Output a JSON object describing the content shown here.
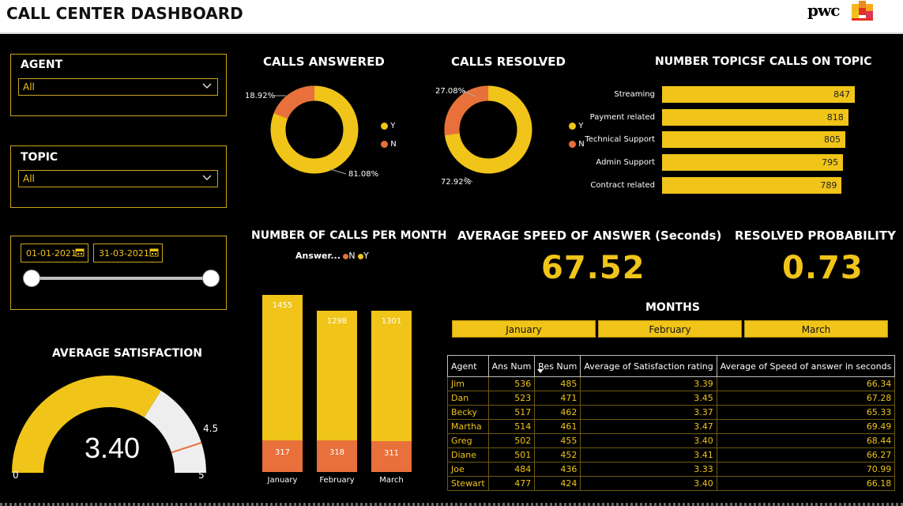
{
  "header": {
    "title": "CALL CENTER DASHBOARD",
    "logo_text": "pwc"
  },
  "colors": {
    "yellow": "#F0C419",
    "orange": "#E8703A",
    "panel_border": "#C7A420",
    "gauge_rest": "#EEEEEE"
  },
  "filters": {
    "agent": {
      "label": "AGENT",
      "value": "All"
    },
    "topic": {
      "label": "TOPIC",
      "value": "All"
    },
    "date": {
      "start": "01-01-2021",
      "end": "31-03-2021"
    }
  },
  "calls_answered": {
    "title": "CALLS ANSWERED",
    "legend": [
      {
        "label": "Y",
        "color": "#F0C419"
      },
      {
        "label": "N",
        "color": "#E8703A"
      }
    ],
    "label_y": "81.08%",
    "label_n": "18.92%"
  },
  "calls_resolved": {
    "title": "CALLS RESOLVED",
    "legend": [
      {
        "label": "Y",
        "color": "#F0C419"
      },
      {
        "label": "N",
        "color": "#E8703A"
      }
    ],
    "label_y": "72.92%",
    "label_n": "27.08%"
  },
  "topics": {
    "title": "NUMBER TOPICSF CALLS ON TOPIC",
    "items": [
      {
        "label": "Streaming",
        "value": "847"
      },
      {
        "label": "Payment related",
        "value": "818"
      },
      {
        "label": "Technical Support",
        "value": "805"
      },
      {
        "label": "Admin Support",
        "value": "795"
      },
      {
        "label": "Contract related",
        "value": "789"
      }
    ]
  },
  "calls_per_month": {
    "title": "NUMBER OF CALLS PER MONTH",
    "legend_title": "Answer...",
    "legend": [
      {
        "label": "N",
        "color": "#E8703A"
      },
      {
        "label": "Y",
        "color": "#F0C419"
      }
    ]
  },
  "avg_speed": {
    "title": "AVERAGE SPEED OF ANSWER (Seconds)",
    "value": "67.52"
  },
  "resolved_prob": {
    "title": "RESOLVED PROBABILITY",
    "value": "0.73"
  },
  "months": {
    "title": "MONTHS",
    "items": [
      "January",
      "February",
      "March"
    ]
  },
  "satisfaction": {
    "title": "AVERAGE SATISFACTION",
    "value_text": "3.40",
    "min_text": "0",
    "max_text": "5",
    "target_text": "4.5",
    "value": 3.4,
    "min": 0,
    "max": 5,
    "target": 4.5
  },
  "table": {
    "columns": [
      "Agent",
      "Ans Num",
      "Res Num",
      "Average of Satisfaction rating",
      "Average of Speed of answer in seconds"
    ],
    "sort_icon": "sort-desc-icon",
    "rows": [
      [
        "Jim",
        "536",
        "485",
        "3.39",
        "66.34"
      ],
      [
        "Dan",
        "523",
        "471",
        "3.45",
        "67.28"
      ],
      [
        "Becky",
        "517",
        "462",
        "3.37",
        "65.33"
      ],
      [
        "Martha",
        "514",
        "461",
        "3.47",
        "69.49"
      ],
      [
        "Greg",
        "502",
        "455",
        "3.40",
        "68.44"
      ],
      [
        "Diane",
        "501",
        "452",
        "3.41",
        "66.27"
      ],
      [
        "Joe",
        "484",
        "436",
        "3.33",
        "70.99"
      ],
      [
        "Stewart",
        "477",
        "424",
        "3.40",
        "66.18"
      ]
    ]
  },
  "chart_data": [
    {
      "type": "pie",
      "title": "CALLS ANSWERED",
      "categories": [
        "Y",
        "N"
      ],
      "values": [
        81.08,
        18.92
      ]
    },
    {
      "type": "pie",
      "title": "CALLS RESOLVED",
      "categories": [
        "Y",
        "N"
      ],
      "values": [
        72.92,
        27.08
      ]
    },
    {
      "type": "bar",
      "title": "NUMBER TOPICSF CALLS ON TOPIC",
      "orientation": "horizontal",
      "categories": [
        "Streaming",
        "Payment related",
        "Technical Support",
        "Admin Support",
        "Contract related"
      ],
      "values": [
        847,
        818,
        805,
        795,
        789
      ],
      "xlim": [
        0,
        930
      ]
    },
    {
      "type": "bar",
      "title": "NUMBER OF CALLS PER MONTH",
      "stacked": true,
      "categories": [
        "January",
        "February",
        "March"
      ],
      "series": [
        {
          "name": "N",
          "values": [
            317,
            318,
            311
          ]
        },
        {
          "name": "Y",
          "values": [
            1455,
            1298,
            1301
          ]
        }
      ],
      "legend": "top"
    }
  ]
}
